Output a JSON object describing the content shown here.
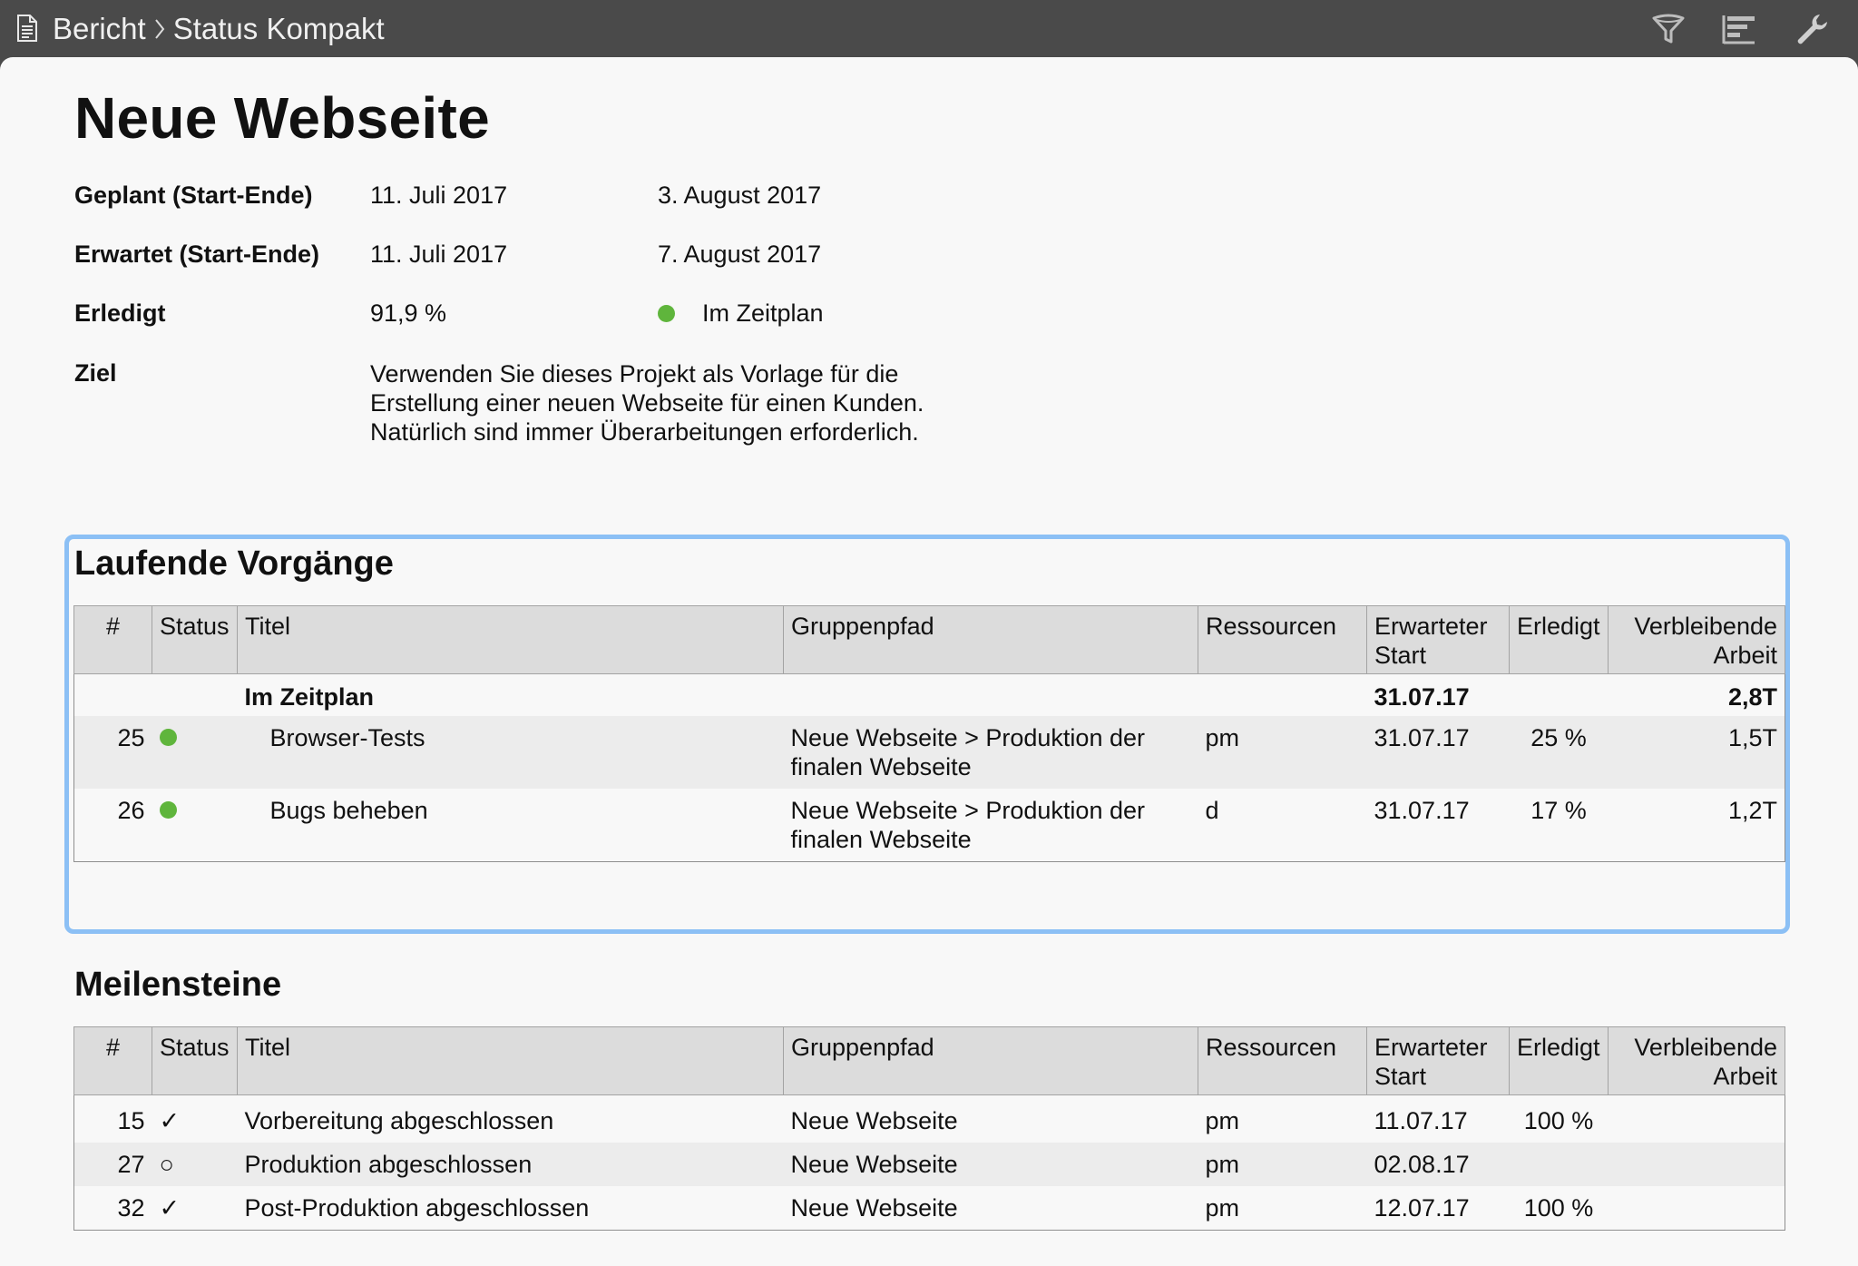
{
  "breadcrumb": {
    "parent": "Bericht",
    "current": "Status Kompakt"
  },
  "toolbar": {
    "icons": [
      "filter-icon",
      "outline-icon",
      "wrench-icon"
    ]
  },
  "report": {
    "title": "Neue Webseite",
    "planned": {
      "label": "Geplant (Start-Ende)",
      "start": "11. Juli 2017",
      "end": "3. August 2017"
    },
    "expected": {
      "label": "Erwartet (Start-Ende)",
      "start": "11. Juli 2017",
      "end": "7. August 2017"
    },
    "done": {
      "label": "Erledigt",
      "value": "91,9 %",
      "status": "Im Zeitplan",
      "status_color": "#5fb53c"
    },
    "goal": {
      "label": "Ziel",
      "lines": [
        "Verwenden Sie dieses Projekt als Vorlage für die",
        "Erstellung einer neuen Webseite für einen Kunden.",
        "Natürlich sind immer Überarbeitungen erforderlich."
      ]
    }
  },
  "columns": {
    "num": "#",
    "status": "Status",
    "title": "Titel",
    "group": "Gruppenpfad",
    "resources": "Ressourcen",
    "start_1": "Erwarteter",
    "start_2": "Start",
    "done": "Erledigt",
    "remaining_1": "Verbleibende",
    "remaining_2": "Arbeit"
  },
  "running": {
    "title": "Laufende Vorgänge",
    "group_row": {
      "title": "Im Zeitplan",
      "start": "31.07.17",
      "remaining": "2,8T"
    },
    "rows": [
      {
        "num": "25",
        "status": "green-dot",
        "title": "Browser-Tests",
        "group_1": "Neue Webseite > Produktion der",
        "group_2": "finalen Webseite",
        "resources": "pm",
        "start": "31.07.17",
        "done": "25 %",
        "remaining": "1,5T"
      },
      {
        "num": "26",
        "status": "green-dot",
        "title": "Bugs beheben",
        "group_1": "Neue Webseite > Produktion der",
        "group_2": "finalen Webseite",
        "resources": "d",
        "start": "31.07.17",
        "done": "17 %",
        "remaining": "1,2T"
      }
    ]
  },
  "milestones": {
    "title": "Meilensteine",
    "rows": [
      {
        "num": "15",
        "status": "✓",
        "title": "Vorbereitung abgeschlossen",
        "group": "Neue Webseite",
        "resources": "pm",
        "start": "11.07.17",
        "done": "100 %",
        "remaining": ""
      },
      {
        "num": "27",
        "status": "○",
        "title": "Produktion abgeschlossen",
        "group": "Neue Webseite",
        "resources": "pm",
        "start": "02.08.17",
        "done": "",
        "remaining": ""
      },
      {
        "num": "32",
        "status": "✓",
        "title": "Post-Produktion abgeschlossen",
        "group": "Neue Webseite",
        "resources": "pm",
        "start": "12.07.17",
        "done": "100 %",
        "remaining": ""
      }
    ]
  }
}
